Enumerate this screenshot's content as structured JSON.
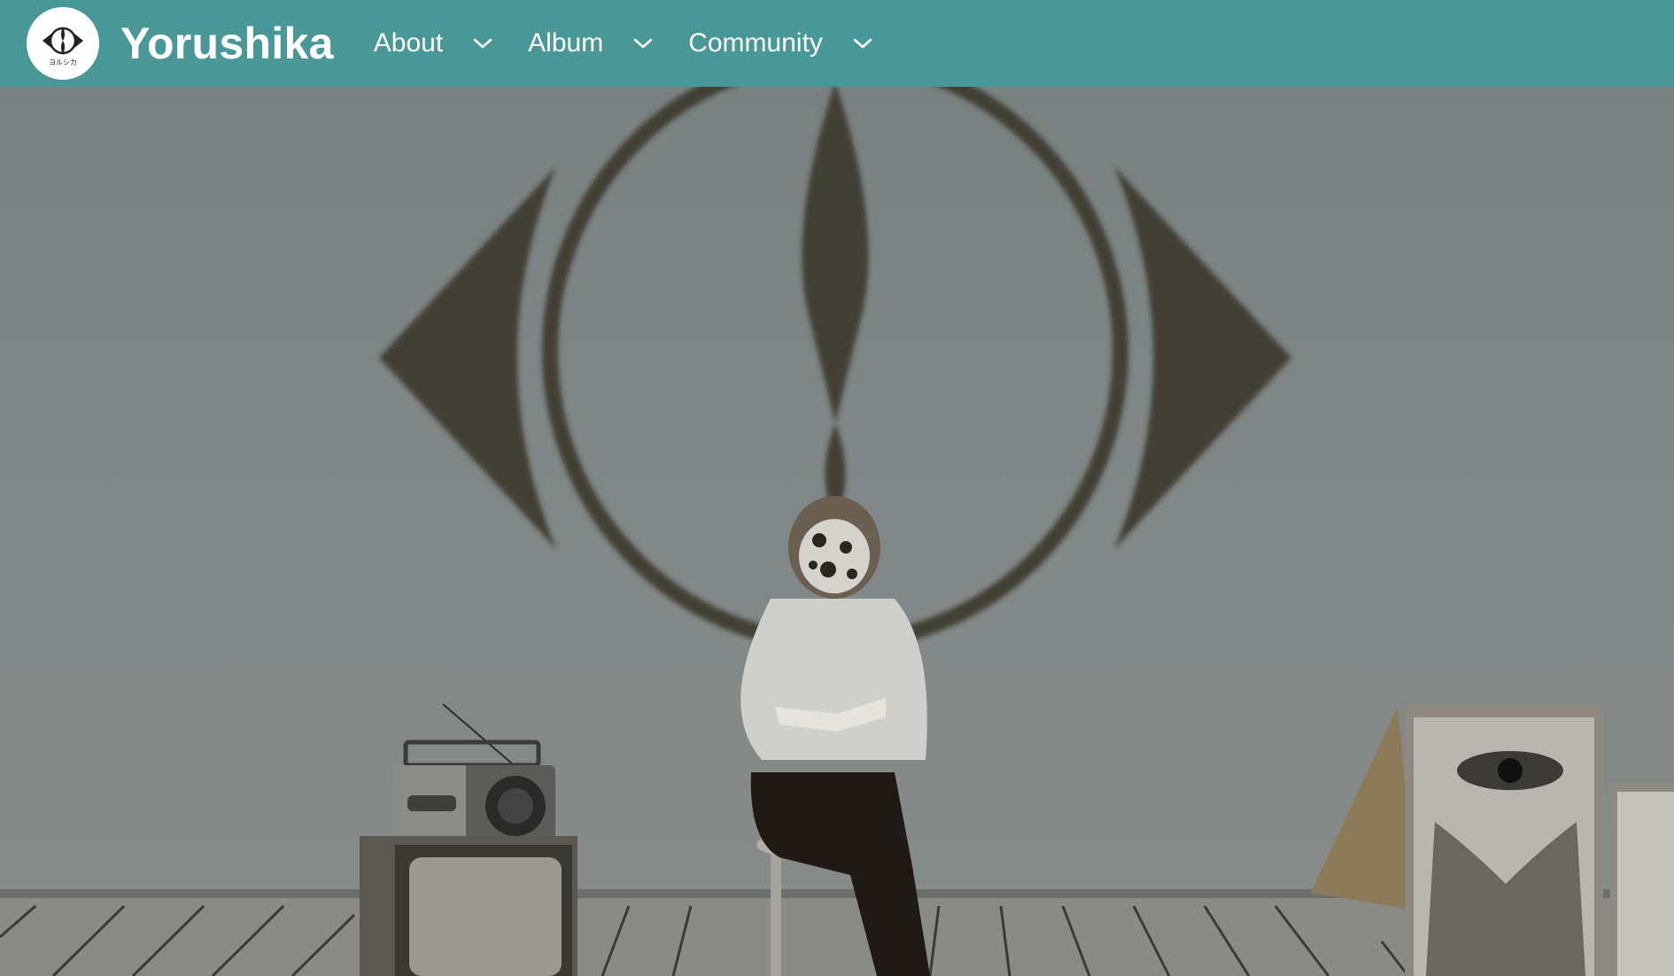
{
  "header": {
    "brand": "Yorushika",
    "logo_icon": "eye-emblem-icon",
    "logo_text": "ヨルシカ",
    "nav": [
      {
        "label": "About",
        "icon": "chevron-down-icon"
      },
      {
        "label": "Album",
        "icon": "chevron-down-icon"
      },
      {
        "label": "Community",
        "icon": "chevron-down-icon"
      }
    ]
  },
  "hero": {
    "description_icon": "eye-projection-icon",
    "colors": {
      "navbar": "#4a9797",
      "wall": "#7d8484",
      "floor": "#8a8b86",
      "projection": "#3d3a2e"
    }
  }
}
